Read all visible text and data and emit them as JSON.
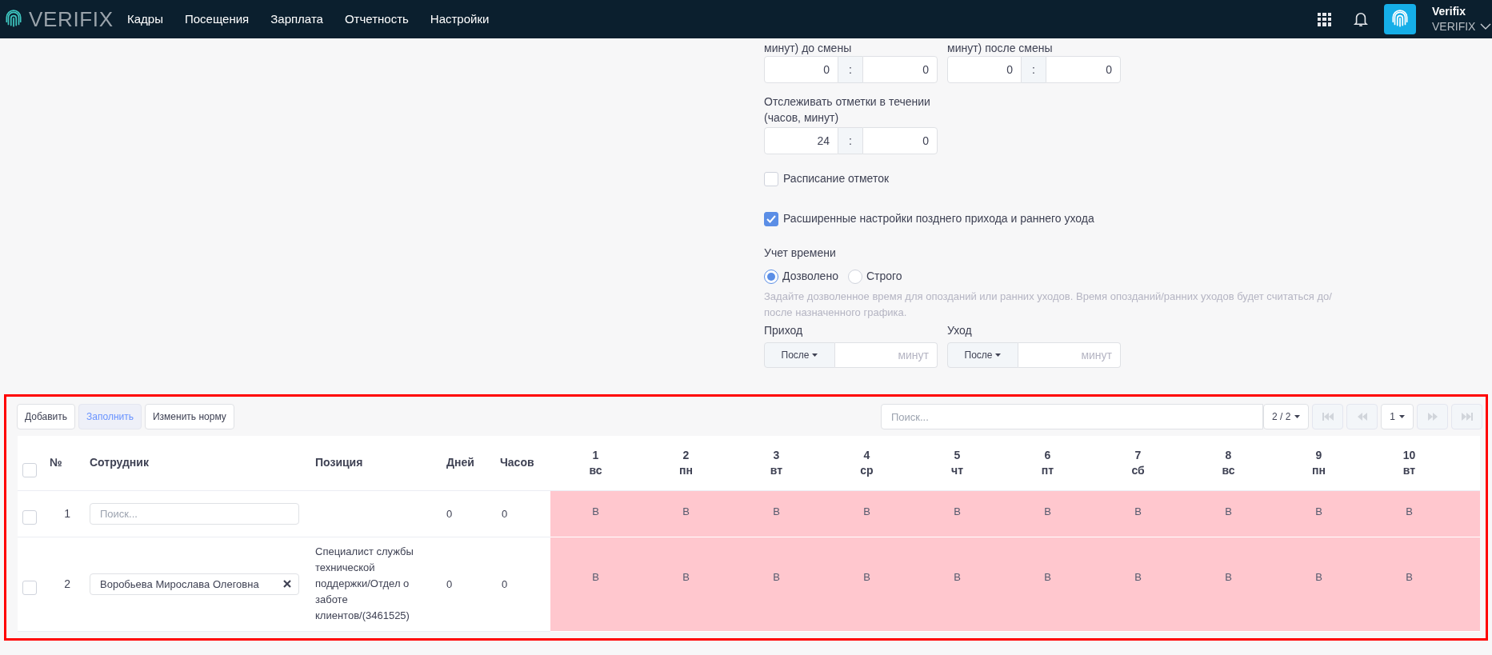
{
  "nav": {
    "logo": "VERIFIX",
    "menu": [
      "Кадры",
      "Посещения",
      "Зарплата",
      "Отчетность",
      "Настройки"
    ],
    "user": {
      "name": "Verifix",
      "org": "VERIFIX"
    }
  },
  "form": {
    "pairs": [
      {
        "label": "минут) до смены",
        "hours": "0",
        "separator": ":",
        "minutes": "0"
      },
      {
        "label": "минут) после смены",
        "hours": "0",
        "separator": ":",
        "minutes": "0"
      }
    ],
    "track": {
      "label": "Отслеживать отметки в течении (часов, минут)",
      "hours": "24",
      "separator": ":",
      "minutes": "0"
    },
    "checkboxes": [
      {
        "label": "Расписание отметок",
        "checked": false
      },
      {
        "label": "Расширенные настройки позднего прихода и раннего ухода",
        "checked": true
      }
    ],
    "time_accounting": {
      "label": "Учет времени",
      "options": [
        {
          "label": "Дозволено",
          "selected": true
        },
        {
          "label": "Строго",
          "selected": false
        }
      ],
      "hint": "Задайте дозволенное время для опозданий или ранних уходов. Время опозданий/ранних уходов будет считаться до/после назначенного графика."
    },
    "limits": [
      {
        "label": "Приход",
        "mode": "После",
        "placeholder": "минут"
      },
      {
        "label": "Уход",
        "mode": "После",
        "placeholder": "минут"
      }
    ]
  },
  "table": {
    "buttons": [
      {
        "label": "Добавить",
        "active": false
      },
      {
        "label": "Заполнить",
        "active": true
      },
      {
        "label": "Изменить норму",
        "active": false
      }
    ],
    "search": {
      "placeholder": "Поиск..."
    },
    "page_count": "2 / 2",
    "page": "1",
    "select_all": {
      "checked": false
    },
    "columns": [
      "№",
      "Сотрудник",
      "Позиция",
      "Дней",
      "Часов"
    ],
    "day_columns": [
      {
        "day": "1",
        "weekday": "вс"
      },
      {
        "day": "2",
        "weekday": "пн"
      },
      {
        "day": "3",
        "weekday": "вт"
      },
      {
        "day": "4",
        "weekday": "ср"
      },
      {
        "day": "5",
        "weekday": "чт"
      },
      {
        "day": "6",
        "weekday": "пт"
      },
      {
        "day": "7",
        "weekday": "сб"
      },
      {
        "day": "8",
        "weekday": "вс"
      },
      {
        "day": "9",
        "weekday": "пн"
      },
      {
        "day": "10",
        "weekday": "вт"
      }
    ],
    "rows": [
      {
        "checked": false,
        "number": "1",
        "employee": {
          "placeholder": "Поиск..."
        },
        "days": "0",
        "hours": "0",
        "cells": [
          "В",
          "В",
          "В",
          "В",
          "В",
          "В",
          "В",
          "В",
          "В",
          "В"
        ]
      },
      {
        "checked": false,
        "number": "2",
        "employee": {
          "value": "Воробьева Мирослава Олеговна"
        },
        "position": "Специалист службы технической поддержки/Отдел о заботе клиентов/(3461525)",
        "days": "0",
        "hours": "0",
        "cells": [
          "В",
          "В",
          "В",
          "В",
          "В",
          "В",
          "В",
          "В",
          "В",
          "В"
        ]
      }
    ]
  }
}
